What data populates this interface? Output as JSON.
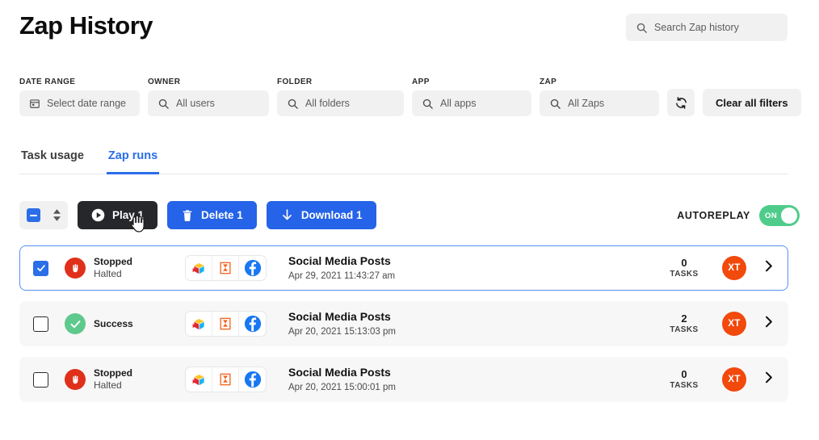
{
  "header": {
    "title": "Zap History",
    "search": {
      "icon": "search-icon",
      "placeholder": "Search Zap history",
      "value": ""
    }
  },
  "filters": {
    "items": [
      {
        "label": "DATE RANGE",
        "icon": "calendar-icon",
        "value": "Select date range"
      },
      {
        "label": "OWNER",
        "icon": "search-icon",
        "value": "All users"
      },
      {
        "label": "FOLDER",
        "icon": "search-icon",
        "value": "All folders"
      },
      {
        "label": "APP",
        "icon": "search-icon",
        "value": "All apps"
      },
      {
        "label": "ZAP",
        "icon": "search-icon",
        "value": "All Zaps"
      }
    ],
    "refresh_icon": "refresh-icon",
    "clear_label": "Clear all filters"
  },
  "tabs": [
    {
      "label": "Task usage",
      "active": false
    },
    {
      "label": "Zap runs",
      "active": true
    }
  ],
  "toolbar": {
    "select_all_state": "indeterminate",
    "sort_icon": "sort-updown-icon",
    "play_label": "Play 1",
    "play_icon": "play-circle-icon",
    "delete_label": "Delete 1",
    "delete_icon": "trash-icon",
    "download_label": "Download 1",
    "download_icon": "download-arrow-icon",
    "autoreplay_label": "AUTOREPLAY",
    "autoreplay_state": "ON"
  },
  "colors": {
    "blue": "#2563e8",
    "tab_blue": "#2b6ee8",
    "dark": "#25272b",
    "green": "#4fcc8b",
    "status_red": "#e0301b",
    "status_green": "#5ec98d",
    "avatar_orange": "#f2490c"
  },
  "rows": [
    {
      "selected": true,
      "checked": true,
      "status_icon": "stop-hand-icon",
      "status_main": "Stopped",
      "status_sub": "Halted",
      "apps": [
        "prism-app-icon",
        "hourglass-delay-icon",
        "facebook-icon"
      ],
      "zap_name": "Social Media Posts",
      "zap_time": "Apr 29, 2021 11:43:27 am",
      "tasks_count": "0",
      "tasks_label": "TASKS",
      "avatar_initials": "XT",
      "chevron": "chevron-right-icon"
    },
    {
      "selected": false,
      "checked": false,
      "status_icon": "check-circle-icon",
      "status_main": "Success",
      "status_sub": "",
      "apps": [
        "prism-app-icon",
        "hourglass-delay-icon",
        "facebook-icon"
      ],
      "zap_name": "Social Media Posts",
      "zap_time": "Apr 20, 2021 15:13:03 pm",
      "tasks_count": "2",
      "tasks_label": "TASKS",
      "avatar_initials": "XT",
      "chevron": "chevron-right-icon"
    },
    {
      "selected": false,
      "checked": false,
      "status_icon": "stop-hand-icon",
      "status_main": "Stopped",
      "status_sub": "Halted",
      "apps": [
        "prism-app-icon",
        "hourglass-delay-icon",
        "facebook-icon"
      ],
      "zap_name": "Social Media Posts",
      "zap_time": "Apr 20, 2021 15:00:01 pm",
      "tasks_count": "0",
      "tasks_label": "TASKS",
      "avatar_initials": "XT",
      "chevron": "chevron-right-icon"
    }
  ]
}
